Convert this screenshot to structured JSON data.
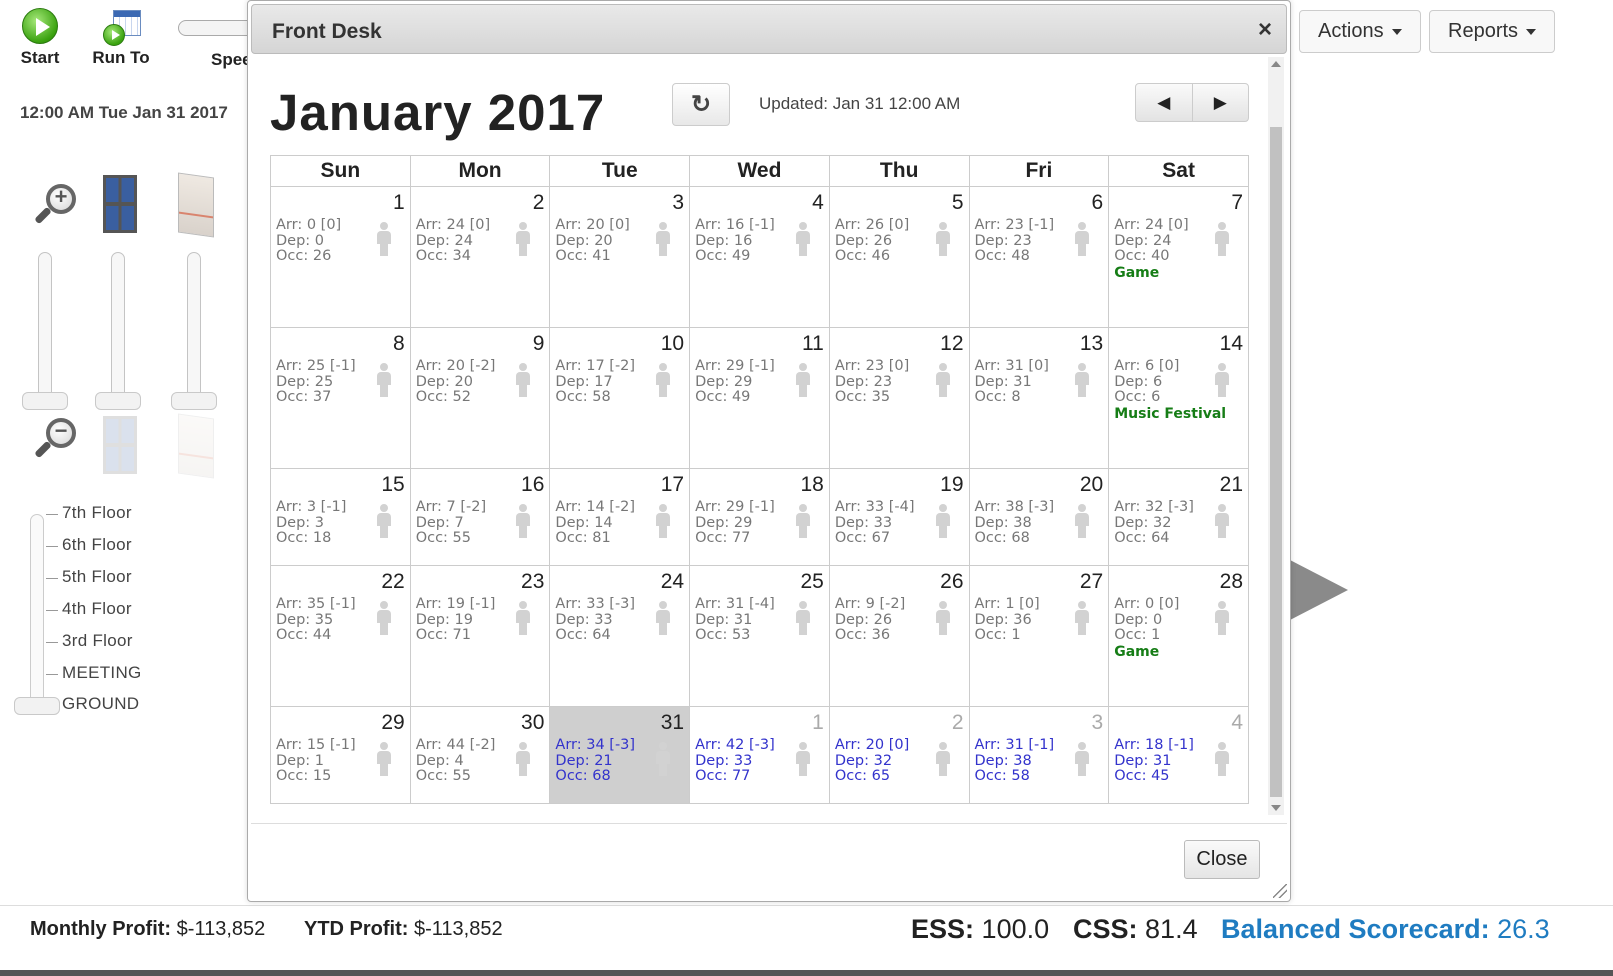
{
  "toolbar": {
    "start_label": "Start",
    "run_to_label": "Run To",
    "speed_label": "Speed"
  },
  "sim_clock": "12:00 AM Tue Jan 31 2017",
  "floors": [
    "7th Floor",
    "6th Floor",
    "5th Floor",
    "4th Floor",
    "3rd Floor",
    "MEETING",
    "GROUND"
  ],
  "top_buttons": {
    "actions": "Actions",
    "reports": "Reports"
  },
  "dialog": {
    "title": "Front Desk",
    "close_x": "×",
    "month": "January 2017",
    "refresh_icon": "↻",
    "updated": "Updated: Jan 31 12:00 AM",
    "prev": "◀",
    "next": "▶",
    "close_button": "Close"
  },
  "calendar": {
    "weekdays": [
      "Sun",
      "Mon",
      "Tue",
      "Wed",
      "Thu",
      "Fri",
      "Sat"
    ],
    "weeks": [
      [
        {
          "day": "1",
          "arr": "Arr: 0 [0]",
          "dep": "Dep: 0",
          "occ": "Occ: 26"
        },
        {
          "day": "2",
          "arr": "Arr: 24 [0]",
          "dep": "Dep: 24",
          "occ": "Occ: 34"
        },
        {
          "day": "3",
          "arr": "Arr: 20 [0]",
          "dep": "Dep: 20",
          "occ": "Occ: 41"
        },
        {
          "day": "4",
          "arr": "Arr: 16 [-1]",
          "dep": "Dep: 16",
          "occ": "Occ: 49"
        },
        {
          "day": "5",
          "arr": "Arr: 26 [0]",
          "dep": "Dep: 26",
          "occ": "Occ: 46"
        },
        {
          "day": "6",
          "arr": "Arr: 23 [-1]",
          "dep": "Dep: 23",
          "occ": "Occ: 48"
        },
        {
          "day": "7",
          "arr": "Arr: 24 [0]",
          "dep": "Dep: 24",
          "occ": "Occ: 40",
          "event": "Game"
        }
      ],
      [
        {
          "day": "8",
          "arr": "Arr: 25 [-1]",
          "dep": "Dep: 25",
          "occ": "Occ: 37"
        },
        {
          "day": "9",
          "arr": "Arr: 20 [-2]",
          "dep": "Dep: 20",
          "occ": "Occ: 52"
        },
        {
          "day": "10",
          "arr": "Arr: 17 [-2]",
          "dep": "Dep: 17",
          "occ": "Occ: 58"
        },
        {
          "day": "11",
          "arr": "Arr: 29 [-1]",
          "dep": "Dep: 29",
          "occ": "Occ: 49"
        },
        {
          "day": "12",
          "arr": "Arr: 23 [0]",
          "dep": "Dep: 23",
          "occ": "Occ: 35"
        },
        {
          "day": "13",
          "arr": "Arr: 31 [0]",
          "dep": "Dep: 31",
          "occ": "Occ: 8"
        },
        {
          "day": "14",
          "arr": "Arr: 6 [0]",
          "dep": "Dep: 6",
          "occ": "Occ: 6",
          "event": "Music Festival"
        }
      ],
      [
        {
          "day": "15",
          "arr": "Arr: 3 [-1]",
          "dep": "Dep: 3",
          "occ": "Occ: 18"
        },
        {
          "day": "16",
          "arr": "Arr: 7 [-2]",
          "dep": "Dep: 7",
          "occ": "Occ: 55"
        },
        {
          "day": "17",
          "arr": "Arr: 14 [-2]",
          "dep": "Dep: 14",
          "occ": "Occ: 81"
        },
        {
          "day": "18",
          "arr": "Arr: 29 [-1]",
          "dep": "Dep: 29",
          "occ": "Occ: 77"
        },
        {
          "day": "19",
          "arr": "Arr: 33 [-4]",
          "dep": "Dep: 33",
          "occ": "Occ: 67"
        },
        {
          "day": "20",
          "arr": "Arr: 38 [-3]",
          "dep": "Dep: 38",
          "occ": "Occ: 68"
        },
        {
          "day": "21",
          "arr": "Arr: 32 [-3]",
          "dep": "Dep: 32",
          "occ": "Occ: 64"
        }
      ],
      [
        {
          "day": "22",
          "arr": "Arr: 35 [-1]",
          "dep": "Dep: 35",
          "occ": "Occ: 44"
        },
        {
          "day": "23",
          "arr": "Arr: 19 [-1]",
          "dep": "Dep: 19",
          "occ": "Occ: 71"
        },
        {
          "day": "24",
          "arr": "Arr: 33 [-3]",
          "dep": "Dep: 33",
          "occ": "Occ: 64"
        },
        {
          "day": "25",
          "arr": "Arr: 31 [-4]",
          "dep": "Dep: 31",
          "occ": "Occ: 53"
        },
        {
          "day": "26",
          "arr": "Arr: 9 [-2]",
          "dep": "Dep: 26",
          "occ": "Occ: 36"
        },
        {
          "day": "27",
          "arr": "Arr: 1 [0]",
          "dep": "Dep: 36",
          "occ": "Occ: 1"
        },
        {
          "day": "28",
          "arr": "Arr: 0 [0]",
          "dep": "Dep: 0",
          "occ": "Occ: 1",
          "event": "Game"
        }
      ],
      [
        {
          "day": "29",
          "arr": "Arr: 15 [-1]",
          "dep": "Dep: 1",
          "occ": "Occ: 15"
        },
        {
          "day": "30",
          "arr": "Arr: 44 [-2]",
          "dep": "Dep: 4",
          "occ": "Occ: 55"
        },
        {
          "day": "31",
          "arr": "Arr: 34 [-3]",
          "dep": "Dep: 21",
          "occ": "Occ: 68",
          "today": true,
          "future": true
        },
        {
          "day": "1",
          "arr": "Arr: 42 [-3]",
          "dep": "Dep: 33",
          "occ": "Occ: 77",
          "other": true,
          "future": true
        },
        {
          "day": "2",
          "arr": "Arr: 20 [0]",
          "dep": "Dep: 32",
          "occ": "Occ: 65",
          "other": true,
          "future": true
        },
        {
          "day": "3",
          "arr": "Arr: 31 [-1]",
          "dep": "Dep: 38",
          "occ": "Occ: 58",
          "other": true,
          "future": true
        },
        {
          "day": "4",
          "arr": "Arr: 18 [-1]",
          "dep": "Dep: 31",
          "occ": "Occ: 45",
          "other": true,
          "future": true
        }
      ]
    ]
  },
  "footer": {
    "monthly_label": "Monthly Profit:",
    "monthly_value": "$-113,852",
    "ytd_label": "YTD Profit:",
    "ytd_value": "$-113,852",
    "ess_label": "ESS:",
    "ess_value": "100.0",
    "css_label": "CSS:",
    "css_value": "81.4",
    "bsc_label": "Balanced Scorecard:",
    "bsc_value": "26.3"
  },
  "colors": {
    "future_text": "#3333cc",
    "event_text": "#167d16",
    "today_bg": "#cfcfcf",
    "scorecard": "#1f7cc1"
  }
}
